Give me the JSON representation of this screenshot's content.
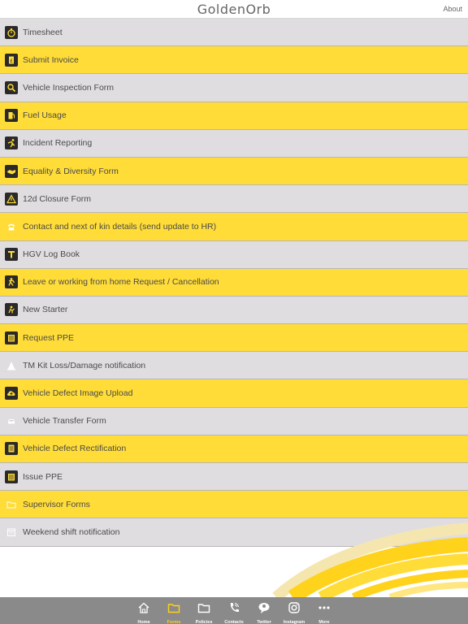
{
  "header": {
    "brand": "GoldenOrb",
    "about": "About"
  },
  "colors": {
    "accent": "#ffdc38",
    "grey_row": "#e0dde1",
    "tabbar": "#8a8a8a",
    "active_tab": "#ffd11a"
  },
  "forms": [
    {
      "label": "Timesheet",
      "icon": "stopwatch-icon"
    },
    {
      "label": "Submit Invoice",
      "icon": "invoice-icon"
    },
    {
      "label": "Vehicle Inspection Form",
      "icon": "magnifier-icon"
    },
    {
      "label": "Fuel Usage",
      "icon": "fuel-pump-icon"
    },
    {
      "label": "Incident Reporting",
      "icon": "falling-person-icon"
    },
    {
      "label": "Equality & Diversity Form",
      "icon": "handshake-icon"
    },
    {
      "label": "12d Closure Form",
      "icon": "warning-icon"
    },
    {
      "label": "Contact and next of kin details (send update to HR)",
      "icon": "phone-icon"
    },
    {
      "label": "HGV Log Book",
      "icon": "t-icon"
    },
    {
      "label": "Leave or working from home Request / Cancellation",
      "icon": "person-leave-icon"
    },
    {
      "label": "New Starter",
      "icon": "new-starter-icon"
    },
    {
      "label": "Request PPE",
      "icon": "ppe-icon"
    },
    {
      "label": "TM Kit Loss/Damage notification",
      "icon": "traffic-cone-icon"
    },
    {
      "label": "Vehicle Defect Image Upload",
      "icon": "cloud-upload-icon"
    },
    {
      "label": "Vehicle Transfer Form",
      "icon": "car-icon"
    },
    {
      "label": "Vehicle Defect Rectification",
      "icon": "checklist-icon"
    },
    {
      "label": "Issue PPE",
      "icon": "ppe-icon"
    },
    {
      "label": "Supervisor Forms",
      "icon": "folder-icon"
    },
    {
      "label": "Weekend shift notification",
      "icon": "calendar-icon"
    }
  ],
  "tabs": [
    {
      "label": "Home",
      "icon": "home-icon"
    },
    {
      "label": "Forms",
      "icon": "folder-icon"
    },
    {
      "label": "Policies",
      "icon": "folder-outline-icon"
    },
    {
      "label": "Contacts",
      "icon": "phone-icon"
    },
    {
      "label": "Twitter",
      "icon": "speech-bubble-icon"
    },
    {
      "label": "Instagram",
      "icon": "camera-icon"
    },
    {
      "label": "More",
      "icon": "more-dots-icon"
    }
  ],
  "active_tab": "Forms"
}
